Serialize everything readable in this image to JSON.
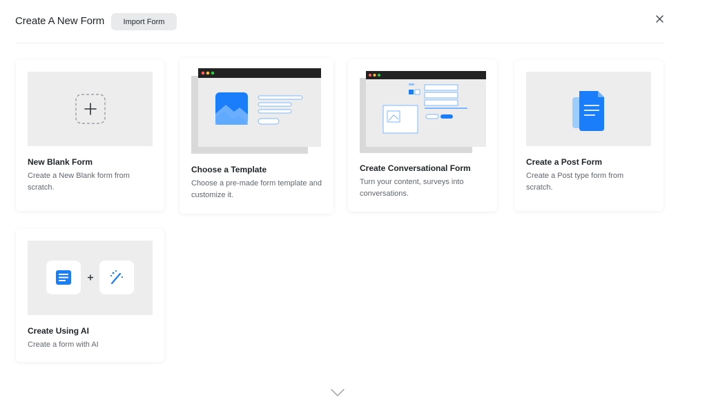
{
  "header": {
    "title": "Create A New Form",
    "import_label": "Import Form",
    "close_icon": "close-icon"
  },
  "cards": [
    {
      "id": "new-blank",
      "title": "New Blank Form",
      "desc": "Create a New Blank form from scratch.",
      "icon": "plus-icon"
    },
    {
      "id": "template",
      "title": "Choose a Template",
      "desc": "Choose a pre-made form template and customize it.",
      "icon": "template-illustration"
    },
    {
      "id": "conversational",
      "title": "Create Conversational Form",
      "desc": "Turn your content, surveys into conversations.",
      "icon": "conversational-illustration"
    },
    {
      "id": "post",
      "title": "Create a Post Form",
      "desc": "Create a Post type form from scratch.",
      "icon": "document-icon"
    },
    {
      "id": "ai",
      "title": "Create Using AI",
      "desc": "Create a form with AI",
      "icon": "form-plus-ai-wand-icons"
    }
  ],
  "footer": {
    "scroll_icon": "chevron-down-icon"
  },
  "colors": {
    "accent": "#1a7efb",
    "thumb_bg": "#ededed",
    "dark_bar": "#222222"
  }
}
